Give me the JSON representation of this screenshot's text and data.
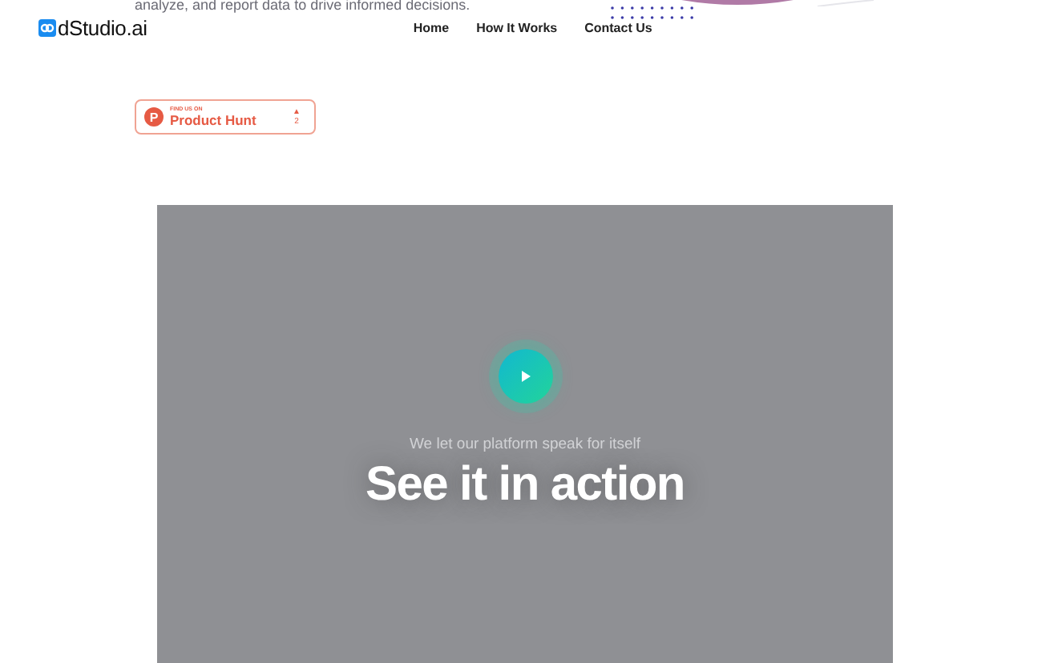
{
  "hero_text": "analyze, and report data to drive informed decisions.",
  "logo": {
    "text": "dStudio.ai"
  },
  "nav": [
    "Home",
    "How It Works",
    "Contact Us"
  ],
  "product_hunt_badge": {
    "caption": "FIND US ON",
    "name": "Product Hunt",
    "letter": "P",
    "arrow": "▲",
    "votes": "2"
  },
  "video": {
    "subtitle": "We let our platform speak for itself",
    "title": "See it in action"
  }
}
